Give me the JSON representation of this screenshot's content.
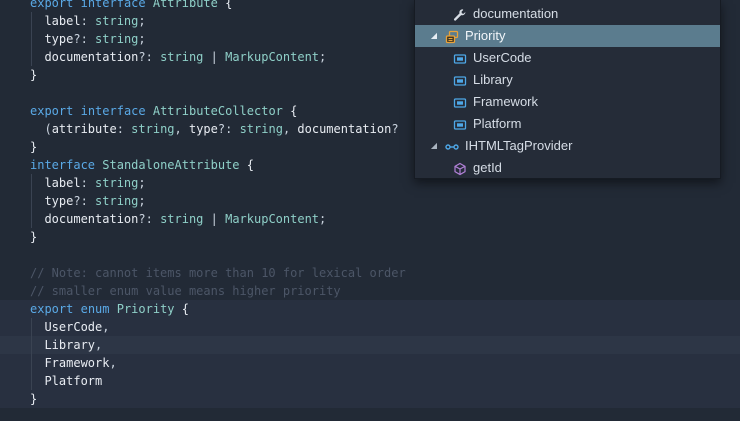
{
  "code": {
    "lines": [
      [
        [
          "kw",
          "export"
        ],
        [
          "op",
          " "
        ],
        [
          "kw",
          "interface"
        ],
        [
          "op",
          " "
        ],
        [
          "ty",
          "Attribute"
        ],
        [
          "op",
          " "
        ],
        [
          "br",
          "{"
        ]
      ],
      [
        [
          "op",
          "  "
        ],
        [
          "pr",
          "label"
        ],
        [
          "op",
          ": "
        ],
        [
          "ty",
          "string"
        ],
        [
          "op",
          ";"
        ]
      ],
      [
        [
          "op",
          "  "
        ],
        [
          "pr",
          "type"
        ],
        [
          "op",
          "?: "
        ],
        [
          "ty",
          "string"
        ],
        [
          "op",
          ";"
        ]
      ],
      [
        [
          "op",
          "  "
        ],
        [
          "pr",
          "documentation"
        ],
        [
          "op",
          "?: "
        ],
        [
          "ty",
          "string"
        ],
        [
          "op",
          " | "
        ],
        [
          "ty",
          "MarkupContent"
        ],
        [
          "op",
          ";"
        ]
      ],
      [
        [
          "br",
          "}"
        ]
      ],
      [],
      [
        [
          "kw",
          "export"
        ],
        [
          "op",
          " "
        ],
        [
          "kw",
          "interface"
        ],
        [
          "op",
          " "
        ],
        [
          "ty",
          "AttributeCollector"
        ],
        [
          "op",
          " "
        ],
        [
          "br",
          "{"
        ]
      ],
      [
        [
          "op",
          "  ("
        ],
        [
          "pr",
          "attribute"
        ],
        [
          "op",
          ": "
        ],
        [
          "ty",
          "string"
        ],
        [
          "op",
          ", "
        ],
        [
          "pr",
          "type"
        ],
        [
          "op",
          "?: "
        ],
        [
          "ty",
          "string"
        ],
        [
          "op",
          ", "
        ],
        [
          "pr",
          "documentation"
        ],
        [
          "op",
          "?"
        ]
      ],
      [
        [
          "br",
          "}"
        ]
      ],
      [
        [
          "kw",
          "interface"
        ],
        [
          "op",
          " "
        ],
        [
          "ty",
          "StandaloneAttribute"
        ],
        [
          "op",
          " "
        ],
        [
          "br",
          "{"
        ]
      ],
      [
        [
          "op",
          "  "
        ],
        [
          "pr",
          "label"
        ],
        [
          "op",
          ": "
        ],
        [
          "ty",
          "string"
        ],
        [
          "op",
          ";"
        ]
      ],
      [
        [
          "op",
          "  "
        ],
        [
          "pr",
          "type"
        ],
        [
          "op",
          "?: "
        ],
        [
          "ty",
          "string"
        ],
        [
          "op",
          ";"
        ]
      ],
      [
        [
          "op",
          "  "
        ],
        [
          "pr",
          "documentation"
        ],
        [
          "op",
          "?: "
        ],
        [
          "ty",
          "string"
        ],
        [
          "op",
          " | "
        ],
        [
          "ty",
          "MarkupContent"
        ],
        [
          "op",
          ";"
        ]
      ],
      [
        [
          "br",
          "}"
        ]
      ],
      [],
      [
        [
          "cm",
          "// Note: cannot items more than 10 for lexical order"
        ]
      ],
      [
        [
          "cm",
          "// smaller enum value means higher priority"
        ]
      ],
      [
        [
          "kw",
          "export"
        ],
        [
          "op",
          " "
        ],
        [
          "kw",
          "enum"
        ],
        [
          "op",
          " "
        ],
        [
          "ty",
          "Priority"
        ],
        [
          "op",
          " "
        ],
        [
          "br",
          "{"
        ]
      ],
      [
        [
          "op",
          "  "
        ],
        [
          "pr",
          "UserCode"
        ],
        [
          "op",
          ","
        ]
      ],
      [
        [
          "op",
          "  "
        ],
        [
          "pr",
          "Library"
        ],
        [
          "op",
          ","
        ]
      ],
      [
        [
          "op",
          "  "
        ],
        [
          "pr",
          "Framework"
        ],
        [
          "op",
          ","
        ]
      ],
      [
        [
          "op",
          "  "
        ],
        [
          "pr",
          "Platform"
        ]
      ],
      [
        [
          "br",
          "}"
        ]
      ]
    ]
  },
  "outline": {
    "items": [
      {
        "label": "documentation",
        "icon": "wrench-icon",
        "level": 1,
        "twisty": ""
      },
      {
        "label": "Priority",
        "icon": "enum-icon",
        "level": 0,
        "twisty": "expanded",
        "selected": true
      },
      {
        "label": "UserCode",
        "icon": "enum-member-icon",
        "level": 1,
        "twisty": ""
      },
      {
        "label": "Library",
        "icon": "enum-member-icon",
        "level": 1,
        "twisty": ""
      },
      {
        "label": "Framework",
        "icon": "enum-member-icon",
        "level": 1,
        "twisty": ""
      },
      {
        "label": "Platform",
        "icon": "enum-member-icon",
        "level": 1,
        "twisty": ""
      },
      {
        "label": "IHTMLTagProvider",
        "icon": "interface-icon",
        "level": 0,
        "twisty": "expanded"
      },
      {
        "label": "getId",
        "icon": "method-icon",
        "level": 1,
        "twisty": ""
      }
    ]
  },
  "colors": {
    "editor_bg": "#222a36",
    "selection": "#5b7c8e",
    "keyword": "#5aa9e6",
    "type": "#8fd0c8",
    "comment": "#4c5667"
  }
}
